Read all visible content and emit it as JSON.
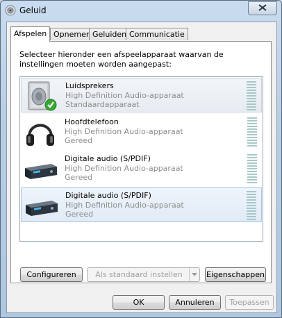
{
  "window": {
    "title": "Geluid",
    "icon": "speaker-icon"
  },
  "tabs": [
    {
      "label": "Afspelen",
      "active": true
    },
    {
      "label": "Opnemen",
      "active": false
    },
    {
      "label": "Geluiden",
      "active": false
    },
    {
      "label": "Communicatie",
      "active": false
    }
  ],
  "instruction": "Selecteer hieronder een afspeelapparaat waarvan de instellingen moeten worden aangepast:",
  "devices": [
    {
      "name": "Luidsprekers",
      "description": "High Definition Audio-apparaat",
      "status": "Standaardapparaat",
      "icon": "speaker-default-icon"
    },
    {
      "name": "Hoofdtelefoon",
      "description": "High Definition Audio-apparaat",
      "status": "Gereed",
      "icon": "headphones-icon"
    },
    {
      "name": "Digitale audio (S/PDIF)",
      "description": "High Definition Audio-apparaat",
      "status": "Gereed",
      "icon": "digital-audio-device-icon"
    },
    {
      "name": "Digitale audio (S/PDIF)",
      "description": "High Definition Audio-apparaat",
      "status": "Gereed",
      "icon": "digital-audio-device-icon"
    }
  ],
  "buttons": {
    "configure": "Configureren",
    "set_default": "Als standaard instellen",
    "properties": "Eigenschappen",
    "ok": "OK",
    "cancel": "Annuleren",
    "apply": "Toepassen"
  },
  "colors": {
    "meter": "#a8c8c8",
    "selection_border": "#aac5e3",
    "default_check": "#3aa635"
  }
}
